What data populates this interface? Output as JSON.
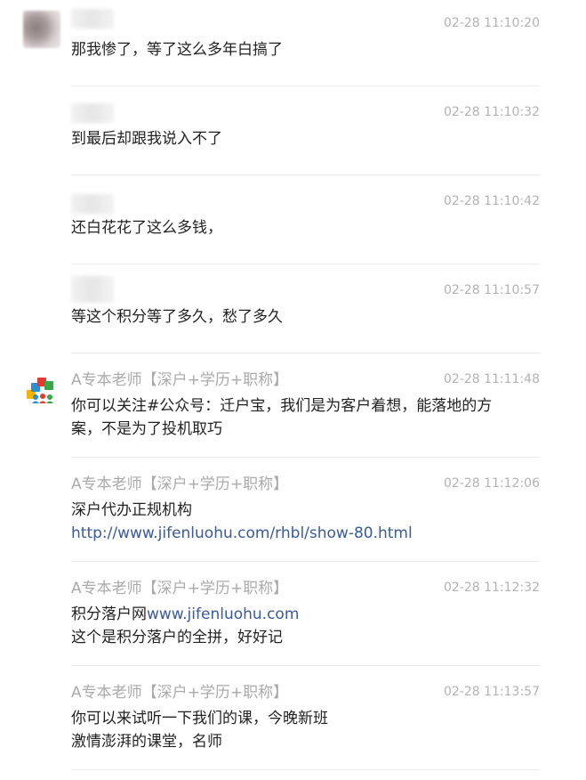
{
  "messages": [
    {
      "sender": "",
      "time": "02-28 11:10:20",
      "lines": [
        "那我惨了，等了这么多年白搞了"
      ]
    },
    {
      "sender": "",
      "time": "02-28 11:10:32",
      "lines": [
        "到最后却跟我说入不了"
      ]
    },
    {
      "sender": "",
      "time": "02-28 11:10:42",
      "lines": [
        "还白花花了这么多钱，"
      ]
    },
    {
      "sender": "",
      "time": "02-28 11:10:57",
      "lines": [
        "等这个积分等了多久，愁了多久"
      ]
    },
    {
      "sender": "A专本老师【深户+学历+职称】",
      "time": "02-28 11:11:48",
      "lines": [
        "你可以关注#公众号：迁户宝，我们是为客户着想，能落地的方",
        "案，不是为了投机取巧"
      ]
    },
    {
      "sender": "A专本老师【深户+学历+职称】",
      "time": "02-28 11:12:06",
      "lines": [
        "深户代办正规机构"
      ],
      "link": "http://www.jifenluohu.com/rhbl/show-80.html"
    },
    {
      "sender": "A专本老师【深户+学历+职称】",
      "time": "02-28 11:12:32",
      "prefix": "积分落户网",
      "link": "www.jifenluohu.com",
      "lines": [
        "这个是积分落户的全拼，好好记"
      ]
    },
    {
      "sender": "A专本老师【深户+学历+职称】",
      "time": "02-28 11:13:57",
      "lines": [
        "你可以来试听一下我们的课，今晚新班",
        "激情澎湃的课堂，名师"
      ]
    }
  ],
  "colors": {
    "sender_name": "#aaaaaa",
    "timestamp": "#b3b3b3",
    "message_text": "#222222",
    "link": "#3a5a9a",
    "divider": "#e8e8e8"
  },
  "icons": {
    "avatar_user": "blurred-avatar",
    "avatar_teacher": "colorful-people-logo-icon"
  }
}
